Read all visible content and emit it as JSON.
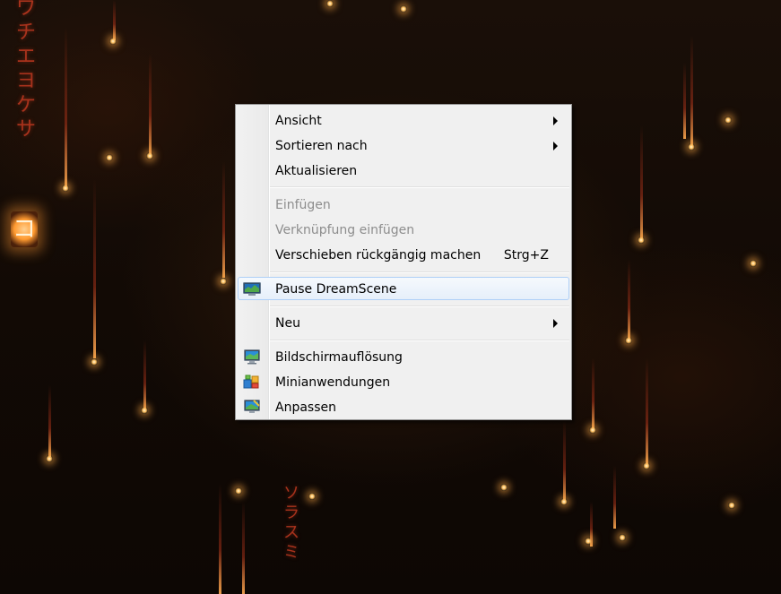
{
  "context_menu": {
    "items": [
      {
        "label": "Ansicht",
        "has_submenu": true,
        "enabled": true
      },
      {
        "label": "Sortieren nach",
        "has_submenu": true,
        "enabled": true
      },
      {
        "label": "Aktualisieren",
        "enabled": true
      },
      {
        "label": "Einfügen",
        "enabled": false
      },
      {
        "label": "Verknüpfung einfügen",
        "enabled": false
      },
      {
        "label": "Verschieben rückgängig machen",
        "shortcut": "Strg+Z",
        "enabled": true
      },
      {
        "label": "Pause DreamScene",
        "icon": "dreamscene-icon",
        "enabled": true,
        "highlighted": true
      },
      {
        "label": "Neu",
        "has_submenu": true,
        "enabled": true
      },
      {
        "label": "Bildschirmauflösung",
        "icon": "display-resolution-icon",
        "enabled": true
      },
      {
        "label": "Minianwendungen",
        "icon": "gadgets-icon",
        "enabled": true
      },
      {
        "label": "Anpassen",
        "icon": "personalize-icon",
        "enabled": true
      }
    ]
  },
  "wallpaper": {
    "glyphs_left": "ワチエヨケサ",
    "glyph_box": "コ",
    "glyphs_bottom": "ソラスミ"
  },
  "colors": {
    "menu_background": "#f0f0f0",
    "highlight_border": "#aecff7",
    "disabled_text": "#8d8d8d"
  }
}
